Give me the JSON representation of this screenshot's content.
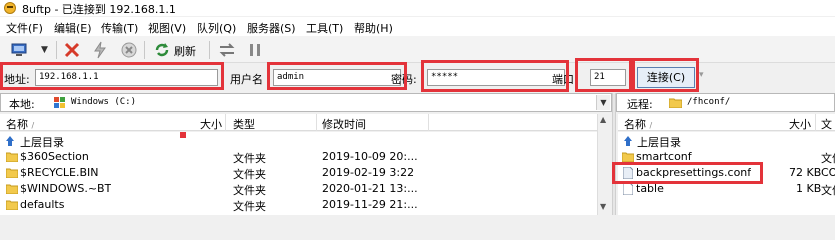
{
  "window": {
    "title": "8uftp - 已连接到 192.168.1.1"
  },
  "menu": [
    "文件(F)",
    "编辑(E)",
    "传输(T)",
    "视图(V)",
    "队列(Q)",
    "服务器(S)",
    "工具(T)",
    "帮助(H)"
  ],
  "toolbar": {
    "refresh_label": "刷新"
  },
  "connection": {
    "address_label": "地址:",
    "address_value": "192.168.1.1",
    "user_label": "用户名",
    "user_value": "admin",
    "password_label": "密码:",
    "password_value": "*****",
    "port_label": "端口",
    "port_value": "21",
    "connect_label": "连接(C)"
  },
  "local": {
    "path_label": "本地:",
    "path_value": "Windows  (C:)",
    "columns": {
      "name": "名称",
      "size": "大小",
      "type": "类型",
      "modified": "修改时间"
    },
    "up_label": "上层目录",
    "rows": [
      {
        "name": "$360Section",
        "type": "文件夹",
        "modified": "2019-10-09 20:..."
      },
      {
        "name": "$RECYCLE.BIN",
        "type": "文件夹",
        "modified": "2019-02-19 3:22"
      },
      {
        "name": "$WINDOWS.~BT",
        "type": "文件夹",
        "modified": "2020-01-21 13:..."
      },
      {
        "name": "defaults",
        "type": "文件夹",
        "modified": "2019-11-29 21:..."
      }
    ]
  },
  "remote": {
    "path_label": "远程:",
    "path_value": "/fhconf/",
    "columns": {
      "name": "名称",
      "size": "大小",
      "type": "文"
    },
    "up_label": "上层目录",
    "rows": [
      {
        "name": "smartconf",
        "size": "",
        "type": "文件",
        "kind": "folder"
      },
      {
        "name": "backpresettings.conf",
        "size": "72 KB",
        "type": "CO",
        "kind": "file"
      },
      {
        "name": "table",
        "size": "1 KB",
        "type": "文件",
        "kind": "file"
      }
    ]
  },
  "colors": {
    "highlight": "#e3333a",
    "folder": "#f2c94c"
  }
}
